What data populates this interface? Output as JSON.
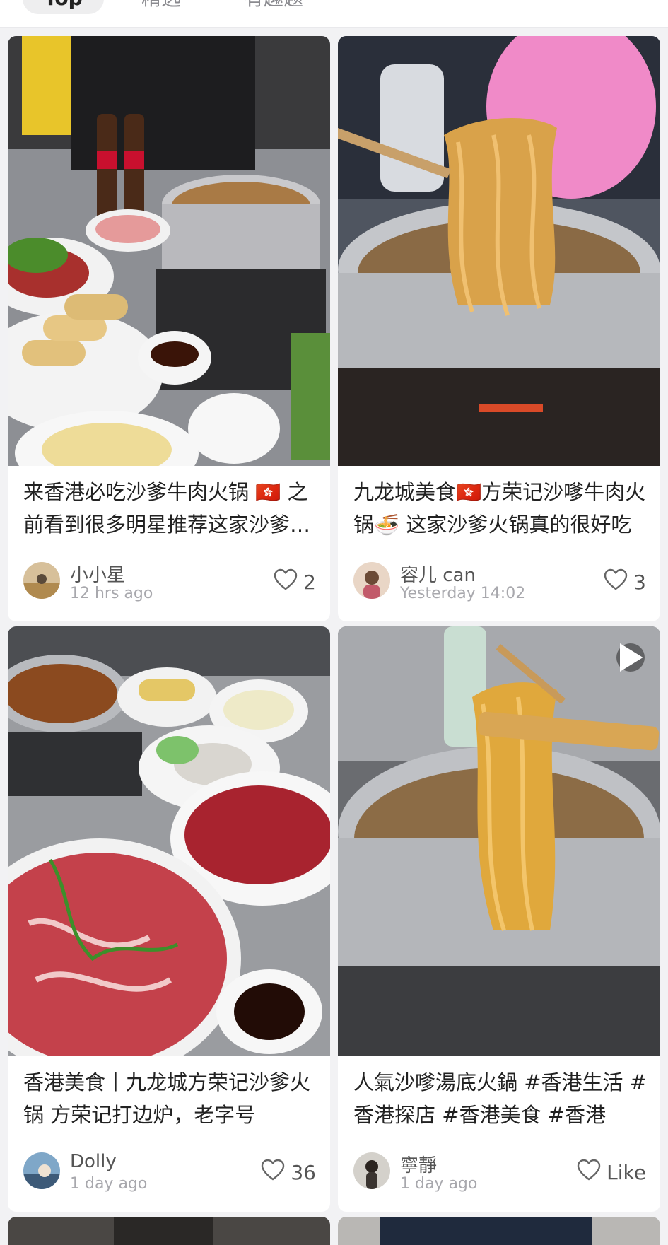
{
  "tabs": [
    {
      "label": "Top",
      "active": true
    },
    {
      "label": "精选"
    },
    {
      "label": "有趣题"
    }
  ],
  "posts": [
    {
      "title": "来香港必吃沙爹牛肉火锅 🇭🇰 之前看到很多明星推荐这家沙爹火锅",
      "author": "小小星",
      "time": "12 hrs ago",
      "likes": "2"
    },
    {
      "title": "九龙城美食🇭🇰方荣记沙嗲牛肉火锅🍜 这家沙爹火锅真的很好吃",
      "author": "容儿 can",
      "time": "Yesterday 14:02",
      "likes": "3"
    },
    {
      "title": "香港美食丨九龙城方荣记沙爹火锅 方荣记打边炉，老字号",
      "author": "Dolly",
      "time": "1 day ago",
      "likes": "36"
    },
    {
      "title": "人氣沙嗲湯底火鍋 #香港生活 #香港探店 #香港美食 #香港",
      "author": "寧靜",
      "time": "1 day ago",
      "likes": "Like",
      "is_video": true
    }
  ],
  "icons": {
    "like": "heart-outline-icon",
    "video": "play-icon"
  },
  "colors": {
    "background": "#f2f2f4",
    "card": "#ffffff",
    "title_text": "#222222",
    "meta_text": "#a8a8ad"
  }
}
